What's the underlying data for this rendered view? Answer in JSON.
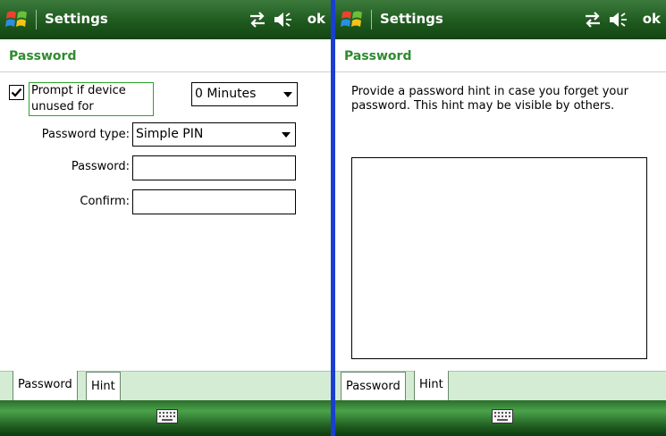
{
  "left": {
    "title": "Settings",
    "ok_label": "ok",
    "page_header": "Password",
    "prompt_checked": true,
    "prompt_label": "Prompt if device unused for",
    "minutes_value": "0 Minutes",
    "password_type_label": "Password type:",
    "password_type_value": "Simple PIN",
    "password_label": "Password:",
    "password_value": "",
    "confirm_label": "Confirm:",
    "confirm_value": "",
    "tabs": [
      {
        "label": "Password",
        "active": true
      },
      {
        "label": "Hint",
        "active": false
      }
    ]
  },
  "right": {
    "title": "Settings",
    "ok_label": "ok",
    "page_header": "Password",
    "hint_instructions": "Provide a password hint in case you forget your password.  This hint may be visible by others.",
    "hint_value": "",
    "tabs": [
      {
        "label": "Password",
        "active": false
      },
      {
        "label": "Hint",
        "active": true
      }
    ]
  },
  "icons": {
    "start": "windows-flag-icon",
    "connectivity": "connectivity-icon",
    "volume": "volume-icon",
    "keyboard": "keyboard-icon"
  },
  "colors": {
    "titlebar": "#1f5a1f",
    "header_text": "#2e8b2e",
    "tab_strip": "#d4ecd4"
  }
}
